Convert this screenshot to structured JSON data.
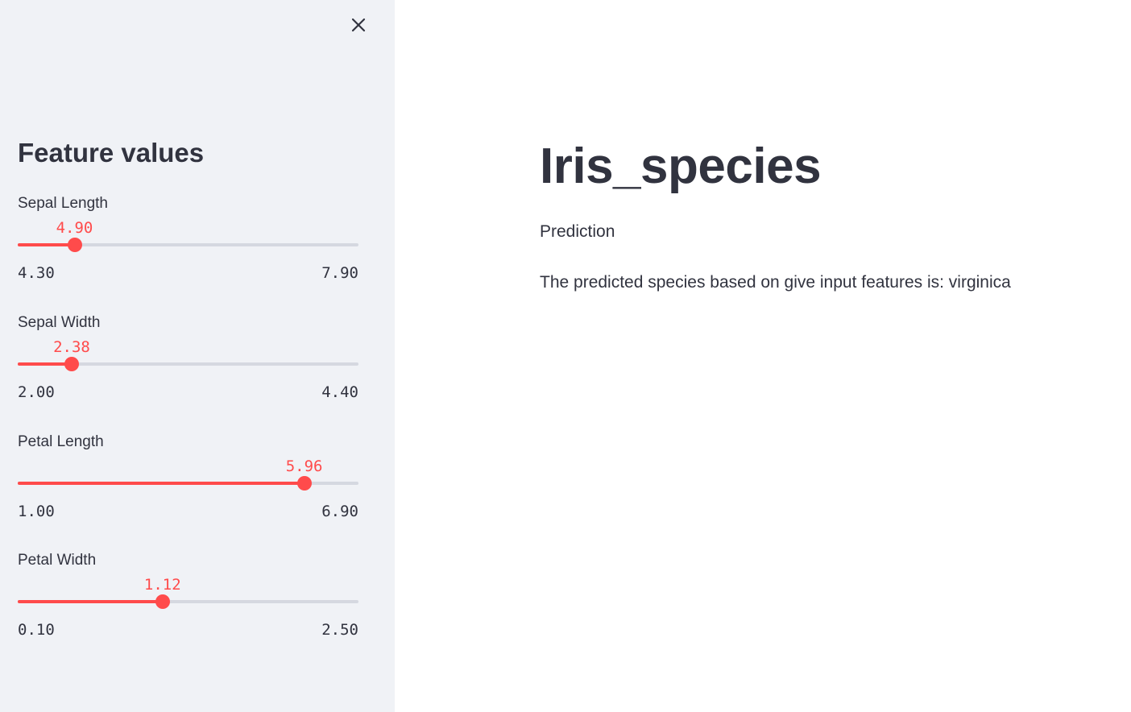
{
  "sidebar": {
    "title": "Feature values",
    "close_icon": "close-icon",
    "sliders": [
      {
        "label": "Sepal Length",
        "value": "4.90",
        "min": "4.30",
        "max": "7.90",
        "fraction": 0.1667
      },
      {
        "label": "Sepal Width",
        "value": "2.38",
        "min": "2.00",
        "max": "4.40",
        "fraction": 0.1583
      },
      {
        "label": "Petal Length",
        "value": "5.96",
        "min": "1.00",
        "max": "6.90",
        "fraction": 0.8407
      },
      {
        "label": "Petal Width",
        "value": "1.12",
        "min": "0.10",
        "max": "2.50",
        "fraction": 0.425
      }
    ]
  },
  "main": {
    "title": "Iris_species",
    "subtitle": "Prediction",
    "result_text": "The predicted species based on give input features is: virginica"
  },
  "colors": {
    "accent": "#ff4b4b",
    "sidebar_bg": "#f0f2f6",
    "text": "#31333f",
    "track": "#d5d8e0"
  }
}
